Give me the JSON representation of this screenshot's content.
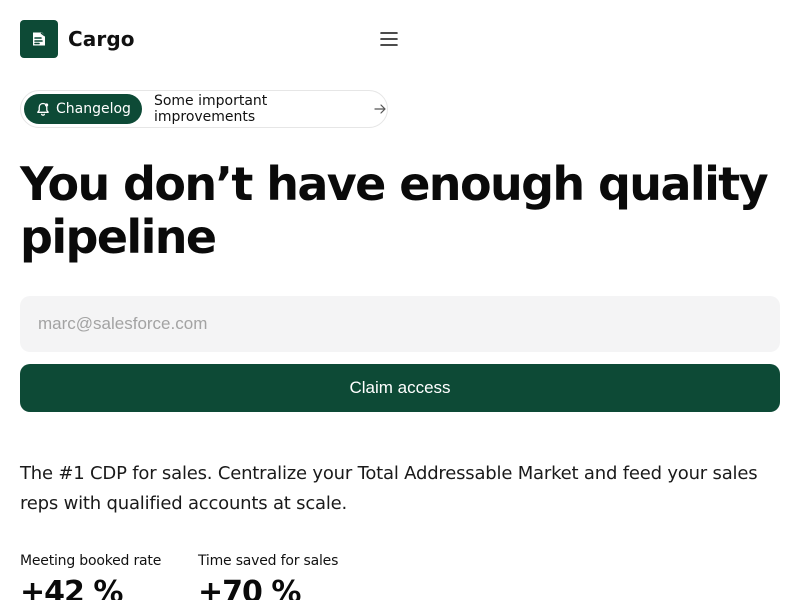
{
  "header": {
    "brand": "Cargo",
    "logo_icon": "cargo-logo-icon",
    "menu_icon": "hamburger-menu-icon"
  },
  "announcement": {
    "tag_label": "Changelog",
    "tag_icon": "bell-icon",
    "text": "Some important improvements",
    "arrow_icon": "arrow-right-icon"
  },
  "hero": {
    "title": "You don’t have enough quality pipeline"
  },
  "signup": {
    "email_placeholder": "marc@salesforce.com",
    "email_value": "",
    "submit_label": "Claim access"
  },
  "description": "The #1 CDP for sales. Centralize your Total Addressable Market and feed your sales reps with qualified accounts at scale.",
  "stats": [
    {
      "label": "Meeting booked rate",
      "value": "+42 %"
    },
    {
      "label": "Time saved for sales",
      "value": "+70 %"
    }
  ],
  "colors": {
    "brand_green": "#0d4a36",
    "input_bg": "#f4f4f5",
    "placeholder": "#a3a3a3",
    "text": "#111111"
  }
}
